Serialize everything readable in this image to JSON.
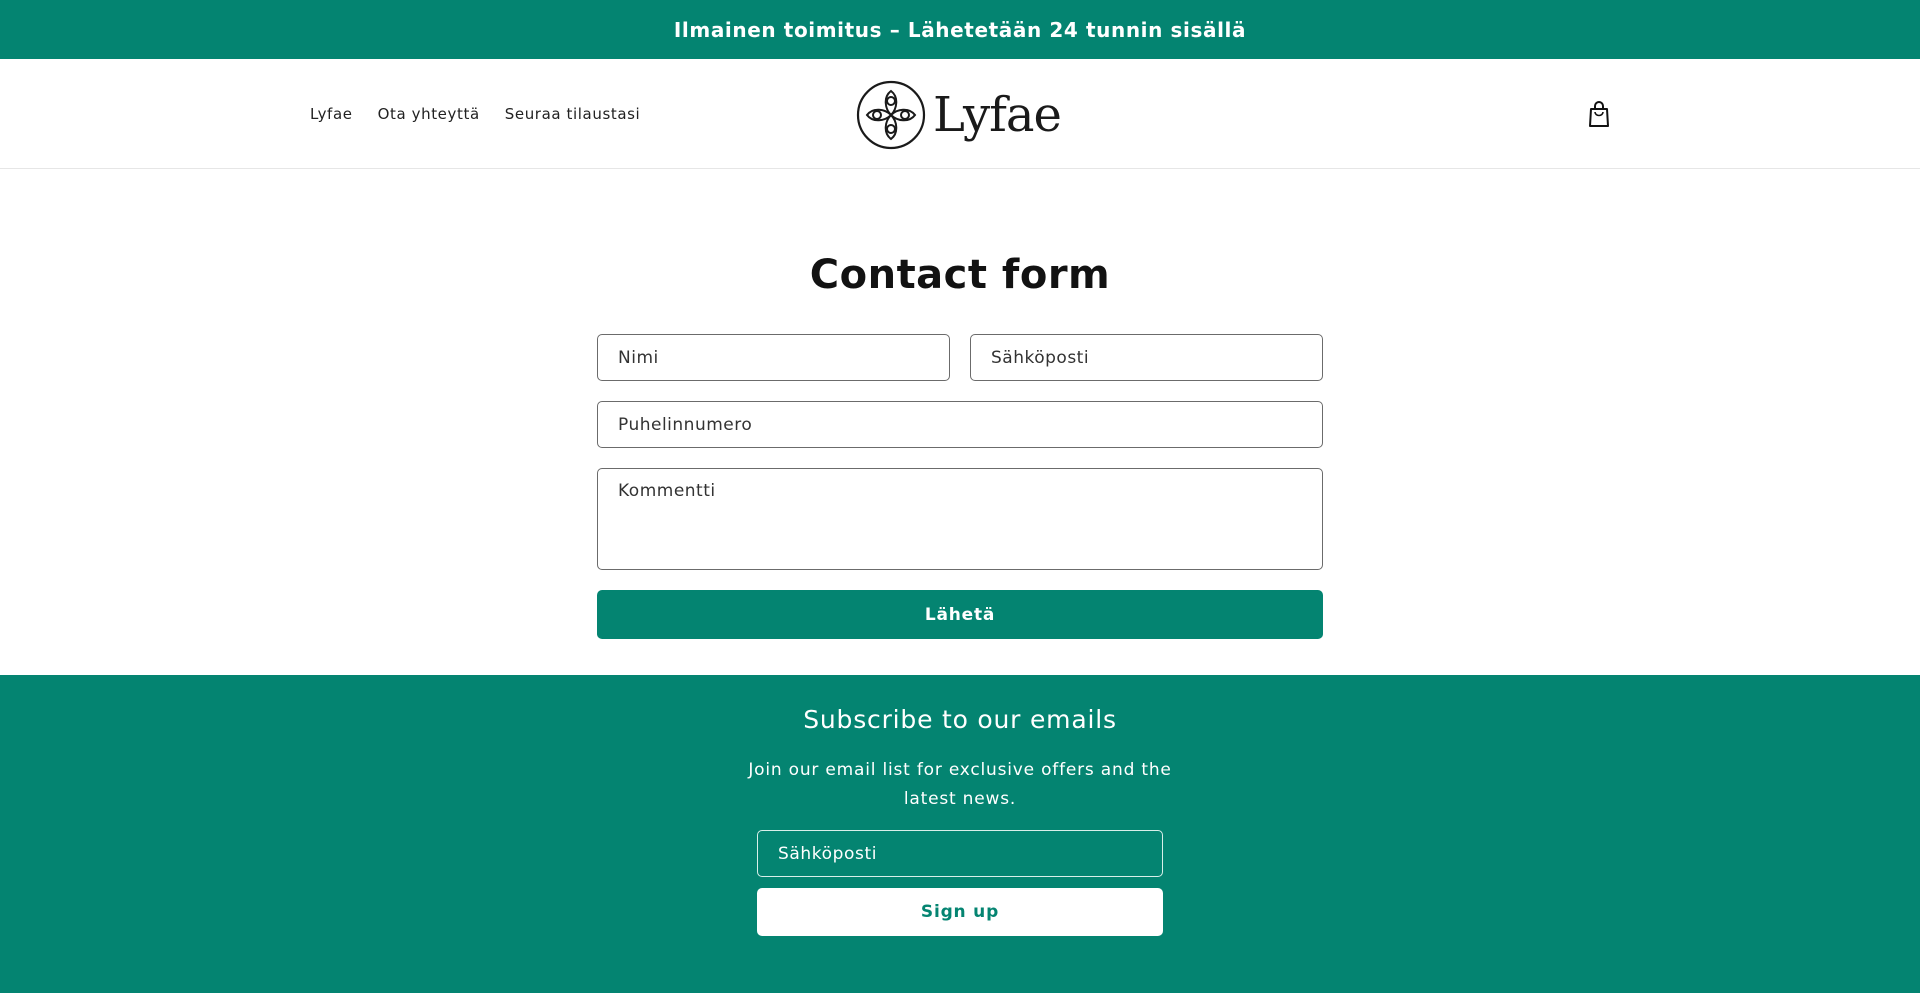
{
  "announcement": {
    "text": "Ilmainen toimitus – Lähetetään 24 tunnin sisällä"
  },
  "header": {
    "nav": [
      {
        "label": "Lyfae"
      },
      {
        "label": "Ota yhteyttä"
      },
      {
        "label": "Seuraa tilaustasi"
      }
    ],
    "logo_text": "Lyfae",
    "cart_icon": "shopping-bag-icon"
  },
  "contact": {
    "title": "Contact form",
    "name_placeholder": "Nimi",
    "email_placeholder": "Sähköposti",
    "phone_placeholder": "Puhelinnumero",
    "comment_placeholder": "Kommentti",
    "submit_label": "Lähetä"
  },
  "newsletter": {
    "title": "Subscribe to our emails",
    "description": "Join our email list for exclusive offers and the latest news.",
    "email_placeholder": "Sähköposti",
    "signup_label": "Sign up"
  },
  "colors": {
    "brand": "#048471",
    "text": "#121212",
    "background": "#ffffff"
  }
}
